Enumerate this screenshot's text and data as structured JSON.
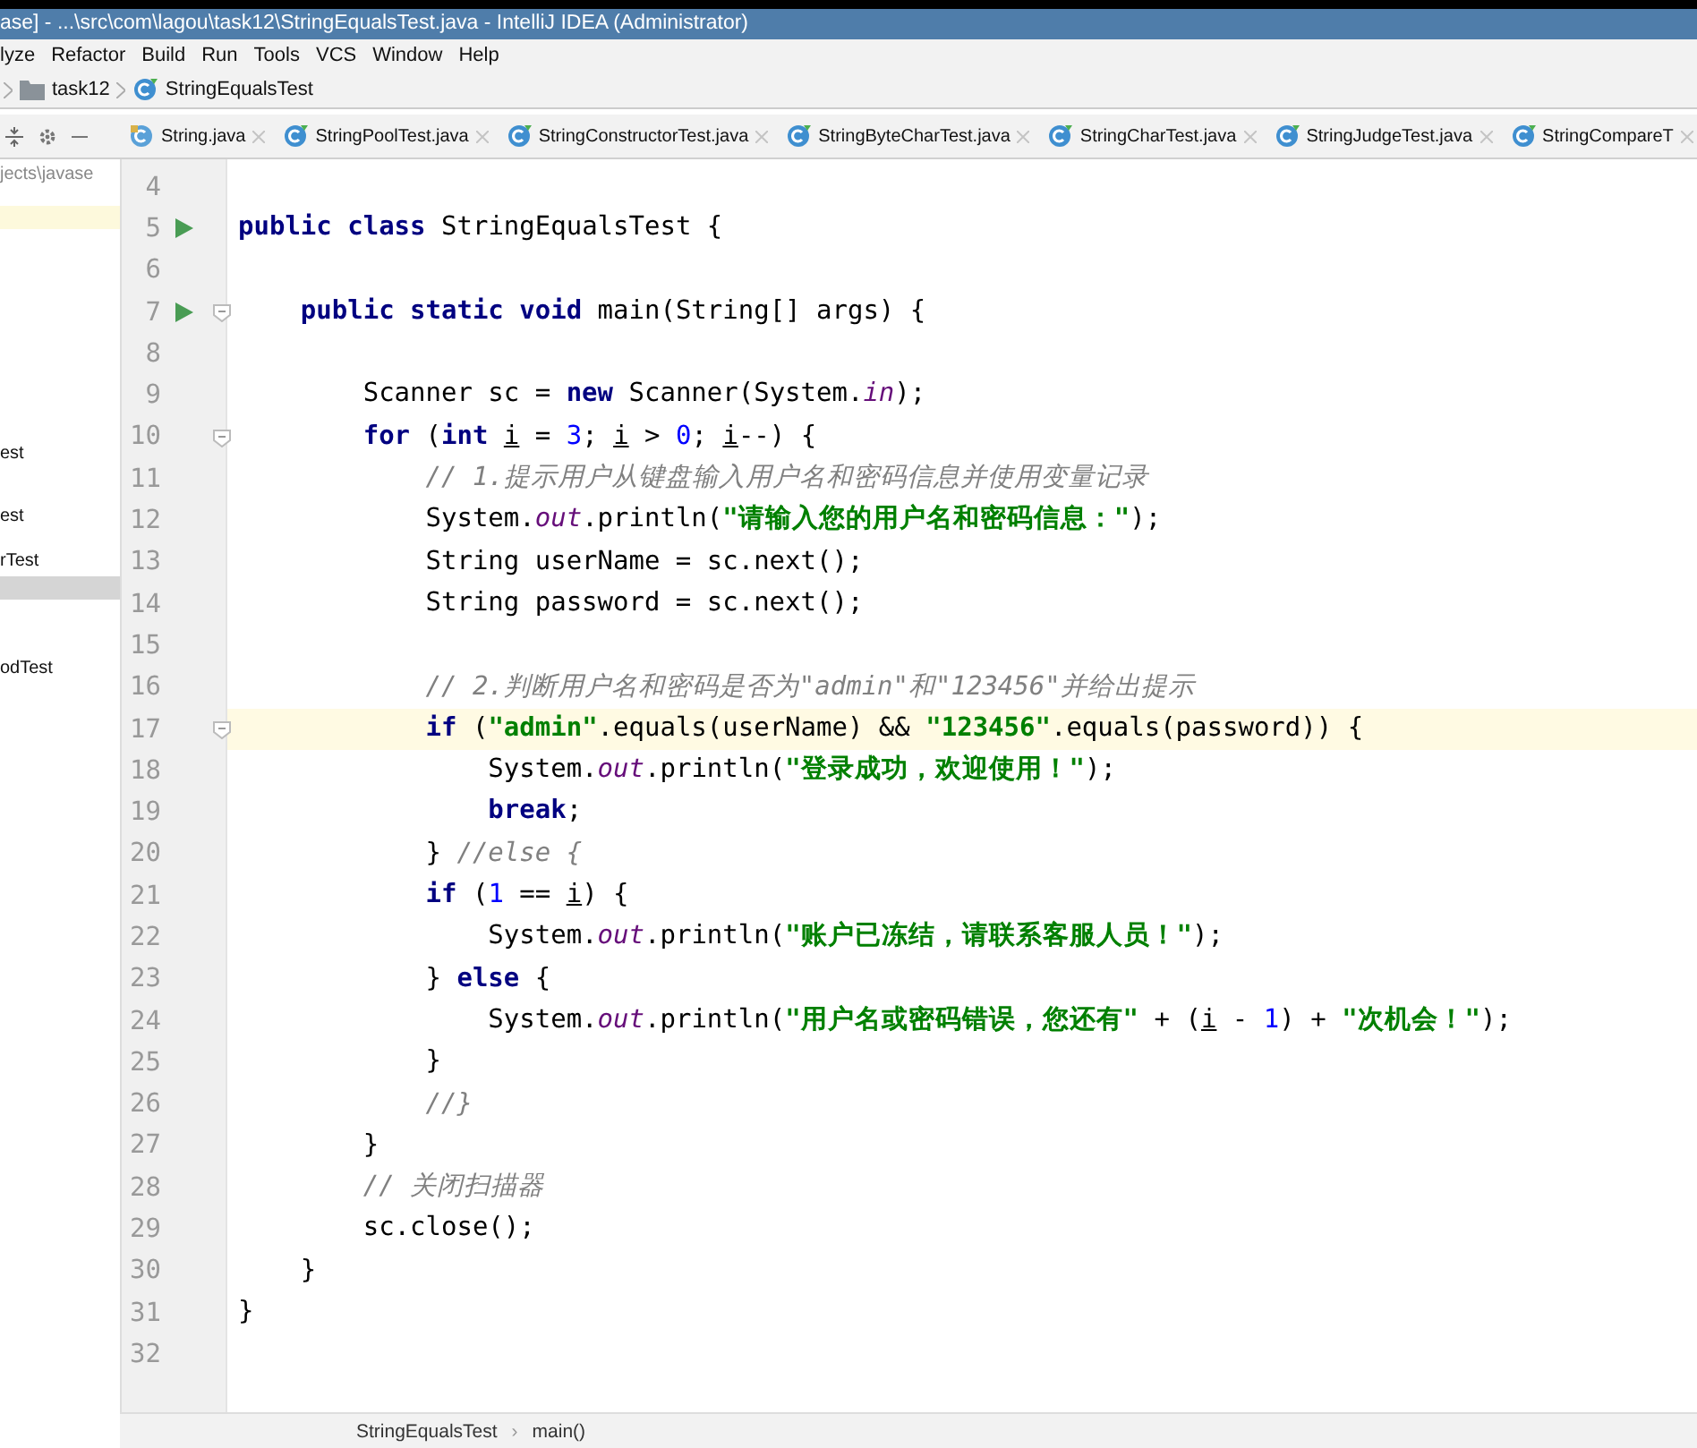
{
  "window": {
    "title": "ase] - ...\\src\\com\\lagou\\task12\\StringEqualsTest.java - IntelliJ IDEA (Administrator)"
  },
  "menu": [
    "lyze",
    "Refactor",
    "Build",
    "Run",
    "Tools",
    "VCS",
    "Window",
    "Help"
  ],
  "breadcrumb": [
    {
      "kind": "folder",
      "label": "task12"
    },
    {
      "kind": "class",
      "label": "StringEqualsTest"
    }
  ],
  "tabs": [
    {
      "kind": "library",
      "label": "String.java",
      "selected": false
    },
    {
      "kind": "class",
      "label": "StringPoolTest.java",
      "selected": false
    },
    {
      "kind": "class",
      "label": "StringConstructorTest.java",
      "selected": false
    },
    {
      "kind": "class",
      "label": "StringByteCharTest.java",
      "selected": false
    },
    {
      "kind": "class",
      "label": "StringCharTest.java",
      "selected": false
    },
    {
      "kind": "class",
      "label": "StringJudgeTest.java",
      "selected": false
    },
    {
      "kind": "class",
      "label": "StringCompareT",
      "selected": false
    }
  ],
  "project": {
    "path": "jects\\javase",
    "items": [
      {
        "selected": false,
        "current": true
      },
      {
        "label": "est",
        "selected": false,
        "current": false
      },
      {
        "label": "est",
        "selected": false,
        "current": false
      },
      {
        "label": "rTest",
        "selected": false,
        "current": false
      },
      {
        "selected": true,
        "current": false
      },
      {
        "label": "odTest",
        "selected": false,
        "current": false
      }
    ]
  },
  "code": [
    {
      "n": "4",
      "run": false,
      "fold": false,
      "current": false
    },
    {
      "n": "5",
      "run": true,
      "fold": false,
      "current": false,
      "tokens": [
        {
          "kind": "k",
          "text": "public class "
        },
        {
          "kind": "p",
          "text": "StringEqualsTest {"
        }
      ]
    },
    {
      "n": "6",
      "run": false,
      "fold": false,
      "current": false
    },
    {
      "n": "7",
      "run": true,
      "fold": true,
      "current": false,
      "tokens": [
        {
          "kind": "k",
          "text": "    public static void "
        },
        {
          "kind": "p",
          "text": "main(String[] args) {"
        }
      ]
    },
    {
      "n": "8",
      "run": false,
      "fold": false,
      "current": false
    },
    {
      "n": "9",
      "run": false,
      "fold": false,
      "current": false,
      "tokens": [
        {
          "kind": "p",
          "text": "        Scanner sc = "
        },
        {
          "kind": "k",
          "text": "new "
        },
        {
          "kind": "p",
          "text": "Scanner(System."
        },
        {
          "kind": "f",
          "text": "in"
        },
        {
          "kind": "p",
          "text": ");"
        }
      ]
    },
    {
      "n": "10",
      "run": false,
      "fold": true,
      "current": false,
      "tokens": [
        {
          "kind": "k",
          "text": "        for "
        },
        {
          "kind": "p",
          "text": "("
        },
        {
          "kind": "k",
          "text": "int "
        },
        {
          "kind": "v",
          "text": "i"
        },
        {
          "kind": "p",
          "text": " = "
        },
        {
          "kind": "n",
          "text": "3"
        },
        {
          "kind": "p",
          "text": "; "
        },
        {
          "kind": "v",
          "text": "i"
        },
        {
          "kind": "p",
          "text": " > "
        },
        {
          "kind": "n",
          "text": "0"
        },
        {
          "kind": "p",
          "text": "; "
        },
        {
          "kind": "v",
          "text": "i"
        },
        {
          "kind": "p",
          "text": "--) {"
        }
      ]
    },
    {
      "n": "11",
      "run": false,
      "fold": false,
      "current": false,
      "tokens": [
        {
          "kind": "c",
          "text": "            // 1.提示用户从键盘输入用户名和密码信息并使用变量记录"
        }
      ]
    },
    {
      "n": "12",
      "run": false,
      "fold": false,
      "current": false,
      "tokens": [
        {
          "kind": "p",
          "text": "            System."
        },
        {
          "kind": "f",
          "text": "out"
        },
        {
          "kind": "p",
          "text": ".println("
        },
        {
          "kind": "s",
          "text": "\"请输入您的用户名和密码信息：\""
        },
        {
          "kind": "p",
          "text": ");"
        }
      ]
    },
    {
      "n": "13",
      "run": false,
      "fold": false,
      "current": false,
      "tokens": [
        {
          "kind": "p",
          "text": "            String userName = sc.next();"
        }
      ]
    },
    {
      "n": "14",
      "run": false,
      "fold": false,
      "current": false,
      "tokens": [
        {
          "kind": "p",
          "text": "            String password = sc.next();"
        }
      ]
    },
    {
      "n": "15",
      "run": false,
      "fold": false,
      "current": false
    },
    {
      "n": "16",
      "run": false,
      "fold": false,
      "current": false,
      "tokens": [
        {
          "kind": "c",
          "text": "            // 2.判断用户名和密码是否为\"admin\"和\"123456\"并给出提示"
        }
      ]
    },
    {
      "n": "17",
      "run": false,
      "fold": true,
      "current": true,
      "tokens": [
        {
          "kind": "k",
          "text": "            if "
        },
        {
          "kind": "p",
          "text": "("
        },
        {
          "kind": "s",
          "text": "\"admin\""
        },
        {
          "kind": "p",
          "text": ".equals(userName) && "
        },
        {
          "kind": "s",
          "text": "\"123456\""
        },
        {
          "kind": "p",
          "text": ".equals(password)) {"
        }
      ]
    },
    {
      "n": "18",
      "run": false,
      "fold": false,
      "current": false,
      "tokens": [
        {
          "kind": "p",
          "text": "                System."
        },
        {
          "kind": "f",
          "text": "out"
        },
        {
          "kind": "p",
          "text": ".println("
        },
        {
          "kind": "s",
          "text": "\"登录成功，欢迎使用！\""
        },
        {
          "kind": "p",
          "text": ");"
        }
      ]
    },
    {
      "n": "19",
      "run": false,
      "fold": false,
      "current": false,
      "tokens": [
        {
          "kind": "k",
          "text": "                break"
        },
        {
          "kind": "p",
          "text": ";"
        }
      ]
    },
    {
      "n": "20",
      "run": false,
      "fold": false,
      "current": false,
      "tokens": [
        {
          "kind": "p",
          "text": "            } "
        },
        {
          "kind": "c",
          "text": "//else {"
        }
      ]
    },
    {
      "n": "21",
      "run": false,
      "fold": false,
      "current": false,
      "tokens": [
        {
          "kind": "k",
          "text": "            if "
        },
        {
          "kind": "p",
          "text": "("
        },
        {
          "kind": "n",
          "text": "1"
        },
        {
          "kind": "p",
          "text": " == "
        },
        {
          "kind": "v",
          "text": "i"
        },
        {
          "kind": "p",
          "text": ") {"
        }
      ]
    },
    {
      "n": "22",
      "run": false,
      "fold": false,
      "current": false,
      "tokens": [
        {
          "kind": "p",
          "text": "                System."
        },
        {
          "kind": "f",
          "text": "out"
        },
        {
          "kind": "p",
          "text": ".println("
        },
        {
          "kind": "s",
          "text": "\"账户已冻结，请联系客服人员！\""
        },
        {
          "kind": "p",
          "text": ");"
        }
      ]
    },
    {
      "n": "23",
      "run": false,
      "fold": false,
      "current": false,
      "tokens": [
        {
          "kind": "p",
          "text": "            } "
        },
        {
          "kind": "k",
          "text": "else "
        },
        {
          "kind": "p",
          "text": "{"
        }
      ]
    },
    {
      "n": "24",
      "run": false,
      "fold": false,
      "current": false,
      "tokens": [
        {
          "kind": "p",
          "text": "                System."
        },
        {
          "kind": "f",
          "text": "out"
        },
        {
          "kind": "p",
          "text": ".println("
        },
        {
          "kind": "s",
          "text": "\"用户名或密码错误，您还有\""
        },
        {
          "kind": "p",
          "text": " + ("
        },
        {
          "kind": "v",
          "text": "i"
        },
        {
          "kind": "p",
          "text": " - "
        },
        {
          "kind": "n",
          "text": "1"
        },
        {
          "kind": "p",
          "text": ") + "
        },
        {
          "kind": "s",
          "text": "\"次机会！\""
        },
        {
          "kind": "p",
          "text": ");"
        }
      ]
    },
    {
      "n": "25",
      "run": false,
      "fold": false,
      "current": false,
      "tokens": [
        {
          "kind": "p",
          "text": "            }"
        }
      ]
    },
    {
      "n": "26",
      "run": false,
      "fold": false,
      "current": false,
      "tokens": [
        {
          "kind": "c",
          "text": "            //}"
        }
      ]
    },
    {
      "n": "27",
      "run": false,
      "fold": false,
      "current": false,
      "tokens": [
        {
          "kind": "p",
          "text": "        }"
        }
      ]
    },
    {
      "n": "28",
      "run": false,
      "fold": false,
      "current": false,
      "tokens": [
        {
          "kind": "c",
          "text": "        // 关闭扫描器"
        }
      ]
    },
    {
      "n": "29",
      "run": false,
      "fold": false,
      "current": false,
      "tokens": [
        {
          "kind": "p",
          "text": "        sc.close();"
        }
      ]
    },
    {
      "n": "30",
      "run": false,
      "fold": false,
      "current": false,
      "tokens": [
        {
          "kind": "p",
          "text": "    }"
        }
      ]
    },
    {
      "n": "31",
      "run": false,
      "fold": false,
      "current": false,
      "tokens": [
        {
          "kind": "p",
          "text": "}"
        }
      ]
    },
    {
      "n": "32",
      "run": false,
      "fold": false,
      "current": false
    }
  ],
  "status_bar": {
    "crumbs": [
      "StringEqualsTest",
      "main()"
    ],
    "separator": "›"
  }
}
